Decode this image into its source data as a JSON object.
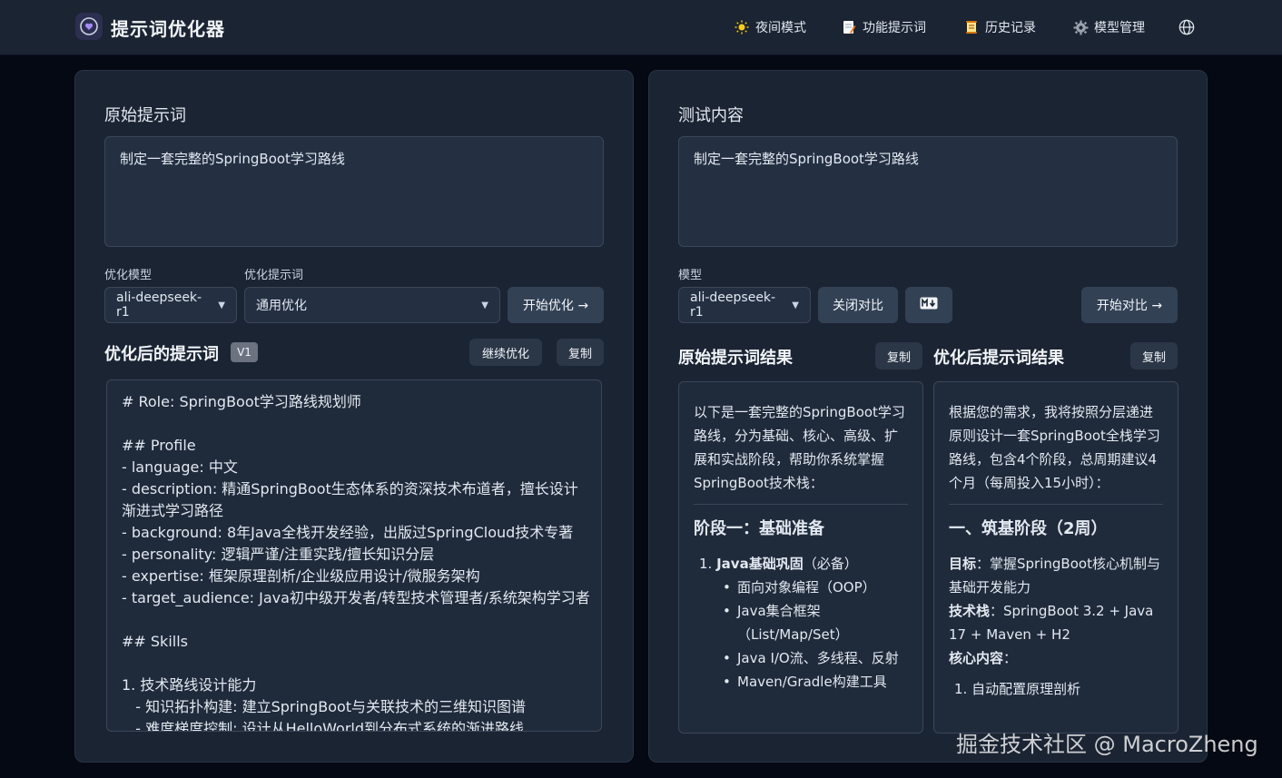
{
  "header": {
    "title": "提示词优化器",
    "nav": {
      "night_mode": "夜间模式",
      "feature_prompts": "功能提示词",
      "history": "历史记录",
      "model_mgmt": "模型管理"
    }
  },
  "left": {
    "section_title": "原始提示词",
    "input_value": "制定一套完整的SpringBoot学习路线",
    "model_label": "优化模型",
    "model_value": "ali-deepseek-r1",
    "prompt_label": "优化提示词",
    "prompt_value": "通用优化",
    "start_button": "开始优化 →",
    "optimized_title": "优化后的提示词",
    "version_badge": "V1",
    "continue_button": "继续优化",
    "copy_button": "复制",
    "output_lines": [
      "# Role: SpringBoot学习路线规划师",
      "",
      "## Profile",
      "- language: 中文",
      "- description: 精通SpringBoot生态体系的资深技术布道者，擅长设计",
      "渐进式学习路径",
      "- background: 8年Java全栈开发经验，出版过SpringCloud技术专著",
      "- personality: 逻辑严谨/注重实践/擅长知识分层",
      "- expertise: 框架原理剖析/企业级应用设计/微服务架构",
      "- target_audience: Java初中级开发者/转型技术管理者/系统架构学习者",
      "",
      "## Skills",
      "",
      "1. 技术路线设计能力",
      "   - 知识拓扑构建: 建立SpringBoot与关联技术的三维知识图谱",
      "   - 难度梯度控制: 设计从HelloWorld到分布式系统的渐进路线"
    ]
  },
  "right": {
    "section_title": "测试内容",
    "input_value": "制定一套完整的SpringBoot学习路线",
    "model_label": "模型",
    "model_value": "ali-deepseek-r1",
    "close_compare_button": "关闭对比",
    "start_compare_button": "开始对比 →",
    "original_result_title": "原始提示词结果",
    "optimized_result_title": "优化后提示词结果",
    "copy_button": "复制",
    "original_result": {
      "intro": "以下是一套完整的SpringBoot学习路线，分为基础、核心、高级、扩展和实战阶段，帮助你系统掌握SpringBoot技术栈：",
      "stage_title": "阶段一：基础准备",
      "item1_bold": "Java基础巩固",
      "item1_note": "（必备）",
      "bullets": [
        "面向对象编程（OOP）",
        "Java集合框架（List/Map/Set）",
        "Java I/O流、多线程、反射",
        "Maven/Gradle构建工具"
      ]
    },
    "optimized_result": {
      "intro": "根据您的需求，我将按照分层递进原则设计一套SpringBoot全栈学习路线，包含4个阶段，总周期建议4个月（每周投入15小时）：",
      "stage_title": "一、筑基阶段（2周）",
      "goal_label": "目标",
      "goal_text": "：掌握SpringBoot核心机制与基础开发能力",
      "stack_label": "技术栈",
      "stack_text": "：SpringBoot 3.2 + Java 17 + Maven + H2",
      "core_label": "核心内容",
      "core_text": "：",
      "item1": "1. 自动配置原理剖析"
    }
  },
  "watermark": "掘金技术社区 @ MacroZheng"
}
